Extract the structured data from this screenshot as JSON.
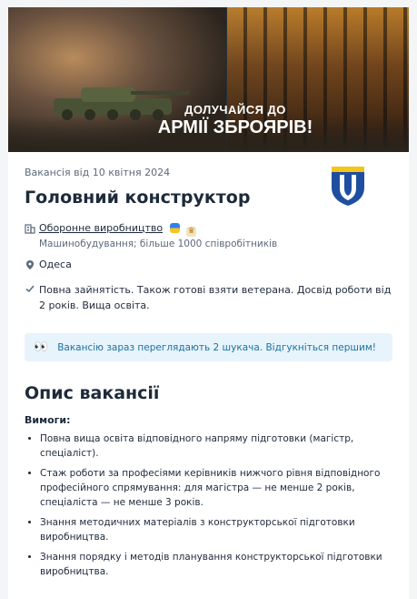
{
  "banner": {
    "headline_small": "ДОЛУЧАЙСЯ ДО",
    "headline_big": "АРМІЇ ЗБРОЯРІВ!"
  },
  "vacancy": {
    "posted": "Вакансія від 10 квітня 2024",
    "title": "Головний конструктор",
    "company": "Оборонне виробництво",
    "company_info": "Машинобудування; більше 1000 співробітників",
    "city": "Одеса",
    "requirements_summary": "Повна зайнятість. Також готові взяти ветерана. Досвід роботи від 2 років. Вища освіта."
  },
  "alert": {
    "icon": "eyes-icon",
    "text": "Вакансію зараз переглядають 2 шукача. Відгукніться першим!"
  },
  "description": {
    "heading": "Опис вакансії",
    "requirements_label": "Вимоги:",
    "items": [
      "Повна вища освіта відповідного напряму підготовки (магістр, спеціаліст).",
      "Стаж роботи за професіями керівників нижчого рівня відповідного професійного спрямування: для магістра — не менше 2 років, спеціаліста — не менше 3 років.",
      "Знання методичних матеріалів з конструкторської підготовки виробництва.",
      "Знання порядку і методів планування конструкторської підготовки виробництва."
    ]
  },
  "colors": {
    "accent": "#1d6fa5",
    "alert_bg": "#e7f4fb",
    "logo_blue": "#1f4ea1",
    "logo_yellow": "#f5c518"
  }
}
